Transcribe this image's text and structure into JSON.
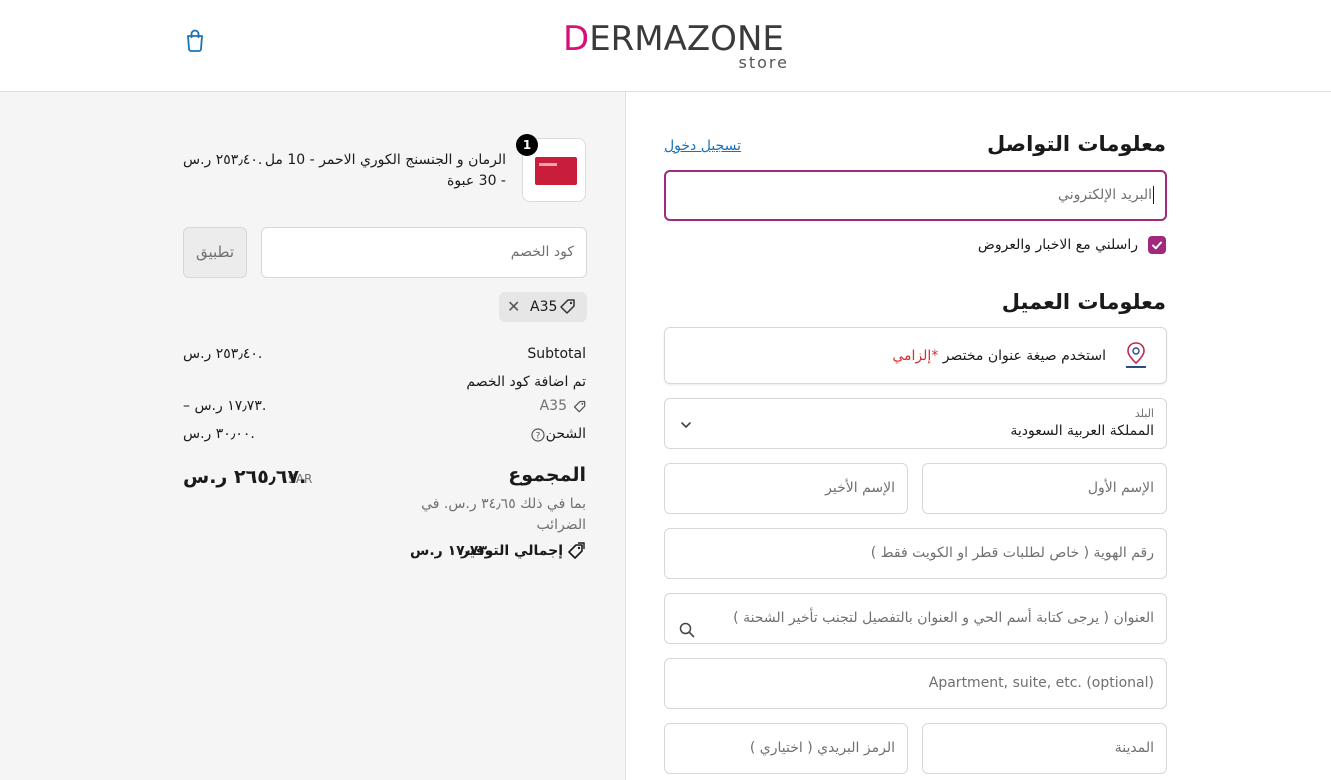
{
  "header": {
    "logo_letter": "D",
    "logo_rest": "ERMAZONE",
    "logo_sub": "store",
    "bag_icon": "shopping-bag-icon"
  },
  "order": {
    "product": {
      "quantity": "1",
      "name": "الرمان و الجنسنج الكوري الاحمر - 10 مل - 30 عبوة",
      "price": "٢٥٣٫٤٠ ر.س."
    },
    "discount": {
      "placeholder": "كود الخصم",
      "apply_label": "تطبيق",
      "applied_code": "A35"
    },
    "summary": {
      "subtotal_label": "Subtotal",
      "subtotal_value": "٢٥٣٫٤٠ ر.س.",
      "discount_label": "تم اضافة كود الخصم",
      "discount_code": "A35",
      "discount_value": "– ١٧٫٧٣ ر.س.",
      "shipping_label": "الشحن",
      "shipping_value": "٣٠٫٠٠ ر.س.",
      "total_label": "المجموع",
      "total_currency": "SAR",
      "total_value": "٢٦٥٫٦٧ ر.س.",
      "tax_note": "بما في ذلك ٣٤٫٦٥ ر.س. في الضرائب",
      "savings_label": "إجمالي التوفير",
      "savings_value": "١٧٫٧٣ ر.س."
    }
  },
  "contact": {
    "title": "معلومات التواصل",
    "login_link": "تسجيل دخول",
    "email_placeholder": "البريد الإلكتروني",
    "newsletter_label": "راسلني مع الاخبار والعروض",
    "newsletter_checked": true
  },
  "customer": {
    "title": "معلومات العميل",
    "short_address_text": "استخدم صيغة عنوان مختصر",
    "short_address_required": "*إلزامي",
    "country_label": "البلد",
    "country_value": "المملكة العربية السعودية",
    "first_name": "الإسم الأول",
    "last_name": "الإسم الأخير",
    "id_number": "رقم الهوية ( خاص لطلبات قطر او الكويت فقط )",
    "address": "العنوان ( يرجى كتابة أسم الحي و العنوان  بالتفصيل لتجنب تأخير الشحنة )",
    "apartment": "Apartment, suite, etc. (optional)",
    "city": "المدينة",
    "postal_code": "الرمز البريدي ( اختياري )"
  },
  "colors": {
    "accent": "#a0287f",
    "brand": "#d6127a",
    "link": "#1a73b8",
    "required": "#d32f2f"
  }
}
